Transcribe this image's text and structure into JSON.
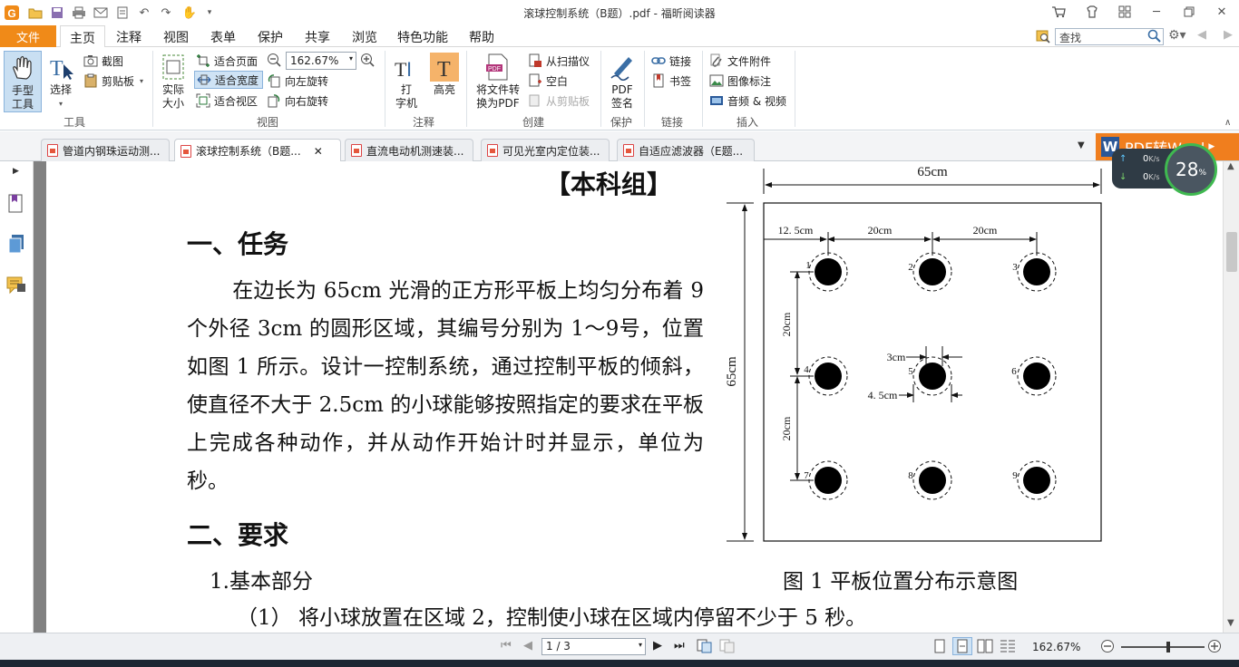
{
  "app": {
    "title": "滚球控制系统（B题）.pdf - 福昕阅读器"
  },
  "menu": {
    "file": "文件",
    "items": [
      "主页",
      "注释",
      "视图",
      "表单",
      "保护",
      "共享",
      "浏览",
      "特色功能",
      "帮助"
    ],
    "search_placeholder": "查找"
  },
  "ribbon": {
    "tools": {
      "hand": "手型\n工具",
      "select": "选择",
      "snapshot": "截图",
      "clipboard": "剪贴板",
      "label": "工具"
    },
    "view": {
      "actual": "实际\n大小",
      "fit_page": "适合页面",
      "fit_width": "适合宽度",
      "fit_visible": "适合视区",
      "zoom": "162.67%",
      "rotate_left": "向左旋转",
      "rotate_right": "向右旋转",
      "label": "视图"
    },
    "comment": {
      "typewriter": "打\n字机",
      "highlight": "高亮",
      "label": "注释"
    },
    "create": {
      "convert": "将文件转\n换为PDF",
      "from_scanner": "从扫描仪",
      "blank": "空白",
      "from_clipboard": "从剪贴板",
      "label": "创建"
    },
    "protect": {
      "sign": "PDF\n签名",
      "label": "保护"
    },
    "links": {
      "link": "链接",
      "bookmark": "书签",
      "label": "链接"
    },
    "insert": {
      "attachment": "文件附件",
      "image": "图像标注",
      "av": "音频 & 视频",
      "label": "插入"
    }
  },
  "tabs": [
    {
      "label": "管道内钢珠运动测..."
    },
    {
      "label": "滚球控制系统（B题...",
      "active": true
    },
    {
      "label": "直流电动机测速装..."
    },
    {
      "label": "可见光室内定位装..."
    },
    {
      "label": "自适应滤波器（E题..."
    }
  ],
  "promo": {
    "label": "PDF转Word"
  },
  "net": {
    "up": "0",
    "down": "0",
    "unit": "K/s",
    "percent": "28",
    "percent_unit": "%"
  },
  "document": {
    "heading": "【本科组】",
    "section1": "一、任务",
    "task_text": "在边长为 65cm 光滑的正方形平板上均匀分布着 9 个外径 3cm 的圆形区域，其编号分别为 1～9号，位置如图 1 所示。设计一控制系统，通过控制平板的倾斜，使直径不大于 2.5cm 的小球能够按照指定的要求在平板上完成各种动作，并从动作开始计时并显示，单位为秒。",
    "section2": "二、要求",
    "basic": "1.基本部分",
    "req1": "（1）  将小球放置在区域 2，控制使小球在区域内停留不少于 5 秒。",
    "figure": {
      "caption": "图 1  平板位置分布示意图",
      "width_label": "65cm",
      "height_label": "65cm",
      "dim_left": "12. 5cm",
      "dim_mid": "20cm",
      "dim_right": "20cm",
      "vdim_top": "20cm",
      "vdim_bottom": "20cm",
      "d3": "3cm",
      "d45": "4. 5cm",
      "numbers": [
        "1",
        "2",
        "3",
        "4",
        "5",
        "6",
        "7",
        "8",
        "9"
      ]
    }
  },
  "status": {
    "page": "1 / 3",
    "zoom": "162.67%"
  }
}
